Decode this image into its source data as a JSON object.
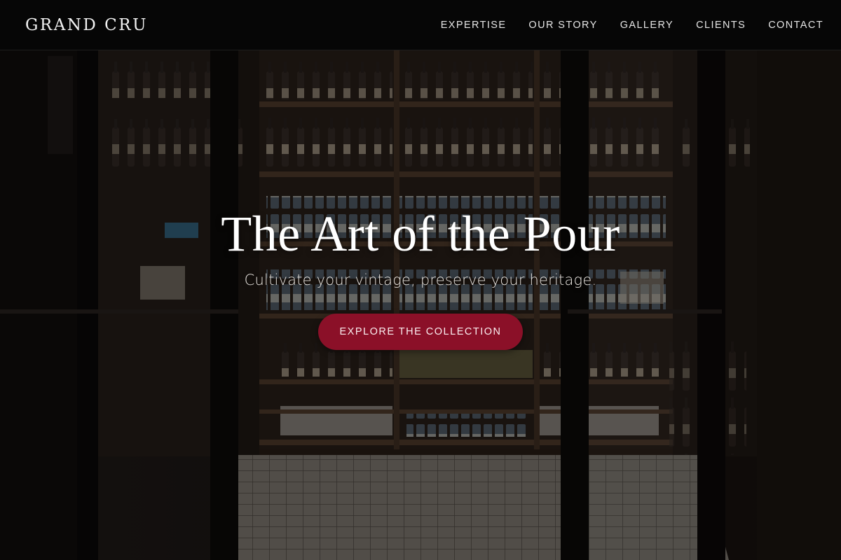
{
  "header": {
    "brand": "GRAND CRU",
    "nav": [
      {
        "label": "EXPERTISE"
      },
      {
        "label": "OUR STORY"
      },
      {
        "label": "GALLERY"
      },
      {
        "label": "CLIENTS"
      },
      {
        "label": "CONTACT"
      }
    ]
  },
  "hero": {
    "title": "The Art of the Pour",
    "subtitle": "Cultivate your vintage, preserve your heritage.",
    "cta_label": "EXPLORE THE COLLECTION",
    "background_icon": "storefront-photo"
  },
  "colors": {
    "header_bg": "#060606",
    "cta_bg": "#8b1028",
    "text": "#ffffff"
  }
}
